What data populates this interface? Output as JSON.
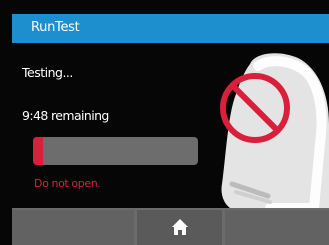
{
  "header": {
    "title": "RunTest"
  },
  "main": {
    "status": "Testing...",
    "remaining": "9:48 remaining",
    "progress": 0.06,
    "warning": "Do not open."
  },
  "footer": {
    "home_icon": "home-icon"
  },
  "illustration": {
    "icon": "no-entry-icon"
  },
  "colors": {
    "header_bg": "#1e8fce",
    "accent_red": "#d8203c",
    "track": "#6d6d6d",
    "footer_bg": "#6b6b6b"
  }
}
